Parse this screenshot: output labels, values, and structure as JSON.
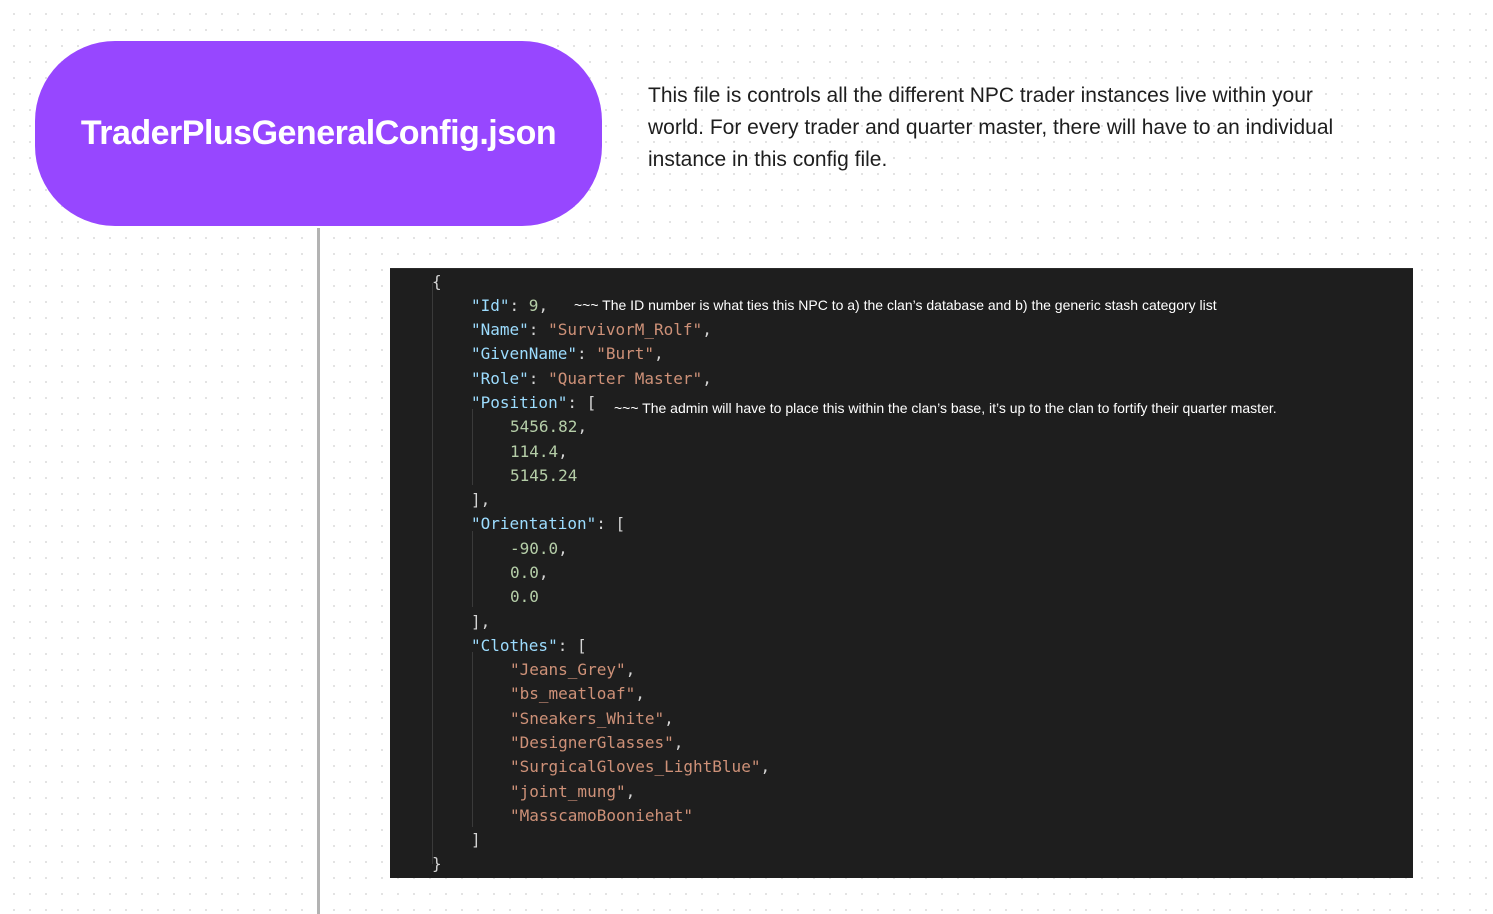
{
  "header": {
    "title": "TraderPlusGeneralConfig.json",
    "description": "This file is controls all the different NPC trader instances live within your world. For every trader and quarter master, there will have to an individual instance in this config file."
  },
  "code": {
    "open_brace": "{",
    "close_brace": "}",
    "id_key": "\"Id\"",
    "id_value": "9",
    "name_key": "\"Name\"",
    "name_value": "\"SurvivorM_Rolf\"",
    "given_name_key": "\"GivenName\"",
    "given_name_value": "\"Burt\"",
    "role_key": "\"Role\"",
    "role_value": "\"Quarter Master\"",
    "position_key": "\"Position\"",
    "position": [
      "5456.82",
      "114.4",
      "5145.24"
    ],
    "orientation_key": "\"Orientation\"",
    "orientation": [
      "-90.0",
      "0.0",
      "0.0"
    ],
    "clothes_key": "\"Clothes\"",
    "clothes": [
      "\"Jeans_Grey\"",
      "\"bs_meatloaf\"",
      "\"Sneakers_White\"",
      "\"DesignerGlasses\"",
      "\"SurgicalGloves_LightBlue\"",
      "\"joint_mung\"",
      "\"MasscamoBooniehat\""
    ]
  },
  "annotations": {
    "id_note": "~~~ The ID number is what ties this NPC to a) the clan’s database and b) the generic stash category list",
    "position_note": "~~~ The admin will have to place this within the clan’s base, it’s up to the clan to fortify their quarter master."
  },
  "colors": {
    "accent": "#9747ff",
    "code_background": "#1e1e1e",
    "json_key": "#9cdcfe",
    "json_string": "#ce9178",
    "json_number": "#b5cea8"
  }
}
